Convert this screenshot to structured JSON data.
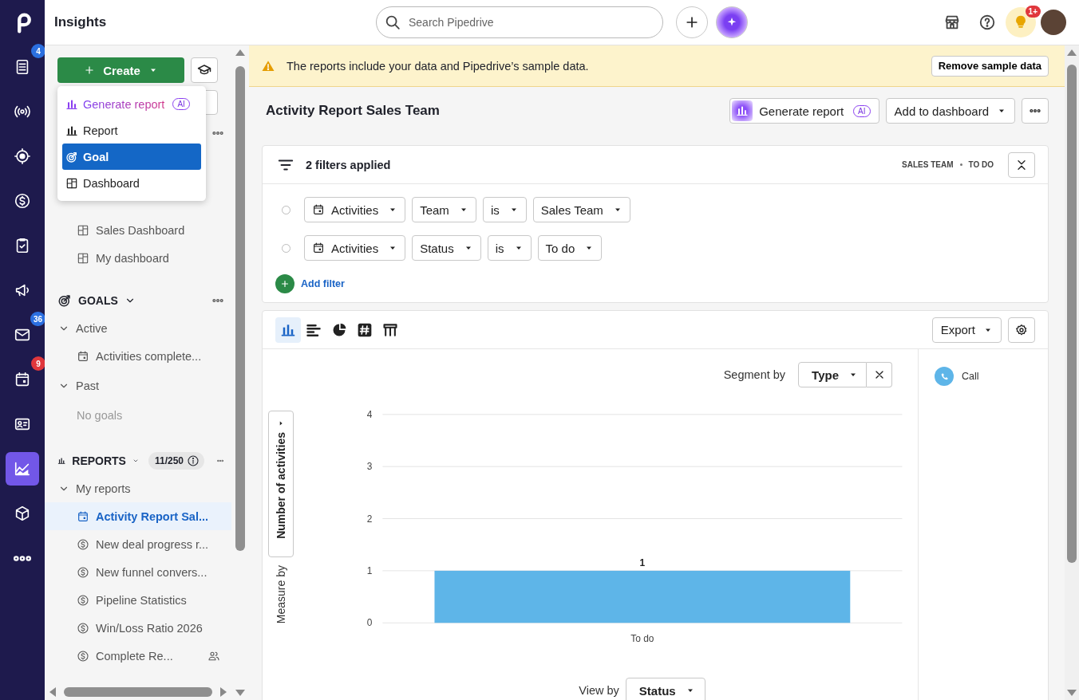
{
  "rail": {
    "items": [
      {
        "selected": false,
        "badge": {
          "text": "4",
          "color": "#2b6fe0"
        }
      },
      {
        "selected": false
      },
      {
        "selected": false
      },
      {
        "selected": false
      },
      {
        "selected": false
      },
      {
        "selected": false
      },
      {
        "selected": false,
        "badge": {
          "text": "36",
          "color": "#2b6fe0"
        }
      },
      {
        "selected": false,
        "badge": {
          "text": "9",
          "color": "#e0373c"
        }
      },
      {
        "selected": false
      },
      {
        "selected": true
      },
      {
        "selected": false
      },
      {
        "selected": false
      }
    ]
  },
  "header": {
    "title": "Insights",
    "search": {
      "placeholder": "Search Pipedrive"
    },
    "notification_badge": "1+"
  },
  "sidebar": {
    "create_button": {
      "label": "Create"
    },
    "create_menu": [
      {
        "label": "Generate report",
        "kind": "ai",
        "badge": "AI",
        "selected": false
      },
      {
        "label": "Report",
        "kind": "report",
        "selected": false
      },
      {
        "label": "Goal",
        "kind": "goal",
        "selected": true
      },
      {
        "label": "Dashboard",
        "kind": "dashboard",
        "selected": false
      }
    ],
    "dashboards": {
      "items": [
        {
          "label": "Sales Dashboard"
        },
        {
          "label": "My dashboard"
        }
      ]
    },
    "goals": {
      "title": "GOALS",
      "expanded": true,
      "children": [
        {
          "label": "Active",
          "expanded": true,
          "children": [
            {
              "label": "Activities complete...",
              "kind": "activity"
            }
          ]
        },
        {
          "label": "Past",
          "expanded": true,
          "empty_text": "No goals"
        }
      ]
    },
    "reports": {
      "title": "REPORTS",
      "expanded": true,
      "count": "11/250",
      "children": [
        {
          "label": "My reports",
          "expanded": true,
          "children": [
            {
              "label": "Activity Report Sal...",
              "kind": "activity",
              "selected": true
            },
            {
              "label": "New deal progress r...",
              "kind": "deal",
              "selected": false
            },
            {
              "label": "New funnel convers...",
              "kind": "deal",
              "selected": false
            },
            {
              "label": "Pipeline Statistics",
              "kind": "deal",
              "selected": false
            },
            {
              "label": "Win/Loss Ratio 2026",
              "kind": "deal",
              "selected": false
            },
            {
              "label": "Complete Re...",
              "kind": "deal",
              "selected": false,
              "shared": true
            }
          ]
        }
      ]
    }
  },
  "banner": {
    "text": "The reports include your data and Pipedrive’s sample data.",
    "button": "Remove sample data"
  },
  "report": {
    "title": "Activity Report Sales Team",
    "generate_button": {
      "label": "Generate report",
      "badge": "AI"
    },
    "dashboard_button": "Add to dashboard",
    "filters": {
      "summary": "2 filters applied",
      "tags": [
        "SALES TEAM",
        "TO DO"
      ],
      "rows": [
        {
          "entity": "Activities",
          "field": "Team",
          "operator": "is",
          "value": "Sales Team"
        },
        {
          "entity": "Activities",
          "field": "Status",
          "operator": "is",
          "value": "To do"
        }
      ],
      "add_label": "Add filter"
    },
    "chart_types": [
      {
        "selected": true
      },
      {
        "selected": false
      },
      {
        "selected": false
      },
      {
        "selected": false
      },
      {
        "selected": false
      }
    ],
    "export_button": "Export",
    "segment_label": "Segment by",
    "segment_value": "Type",
    "measure_label": "Measure by",
    "measure_value": "Number of activities",
    "view_label": "View by",
    "view_value": "Status",
    "chart_data": {
      "type": "bar",
      "categories": [
        "To do"
      ],
      "series": [
        {
          "name": "Call",
          "color": "#5eb5e8",
          "values": [
            1
          ]
        }
      ],
      "ylim": [
        0,
        4
      ],
      "yticks": [
        0,
        1,
        2,
        3,
        4
      ],
      "grid": true,
      "data_labels": true
    }
  }
}
